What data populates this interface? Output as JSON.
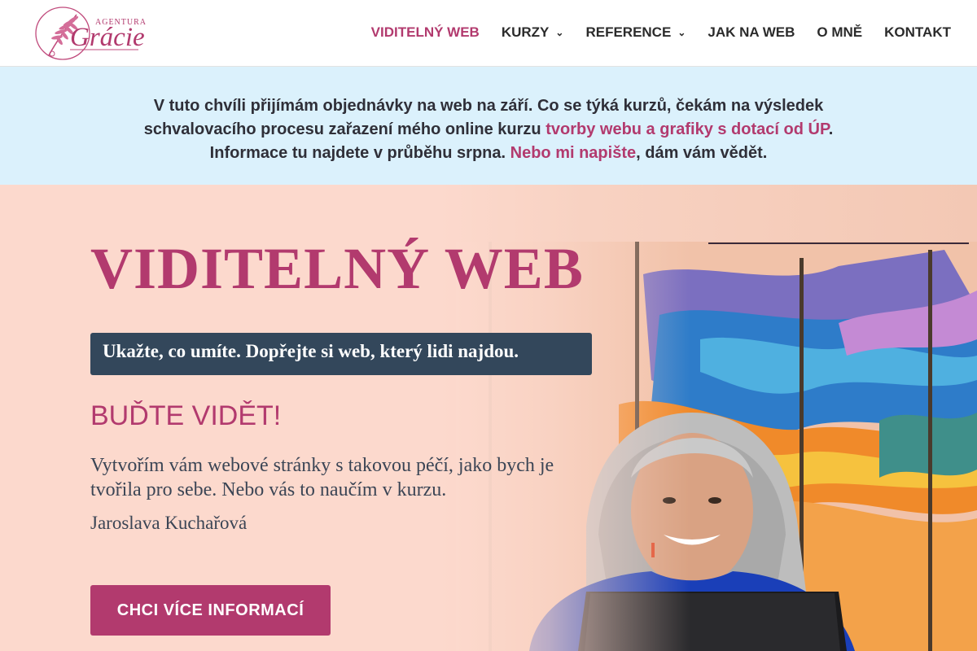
{
  "logo": {
    "small_text": "AGENTURA",
    "main_text": "Grácie"
  },
  "nav": {
    "items": [
      {
        "label": "VIDITELNÝ WEB"
      },
      {
        "label": "KURZY"
      },
      {
        "label": "REFERENCE"
      },
      {
        "label": "JAK NA WEB"
      },
      {
        "label": "O MNĚ"
      },
      {
        "label": "KONTAKT"
      }
    ]
  },
  "notice": {
    "line1": "V tuto chvíli přijímám objednávky na web na září. Co se týká kurzů, čekám na výsledek",
    "line2_before": "schvalovacího procesu zařazení mého online kurzu ",
    "line2_link": "tvorby webu a grafiky s dotací od ÚP",
    "line2_after": ".",
    "line3_before": "Informace tu najdete v průběhu srpna. ",
    "line3_link": "Nebo mi napište",
    "line3_after": ", dám vám vědět."
  },
  "hero": {
    "title": "VIDITELNÝ WEB",
    "tagline": "Ukažte, co umíte. Dopřejte si web, který lidi najdou.",
    "subheading": "BUĎTE VIDĚT!",
    "description": "Vytvořím vám webové stránky s takovou péčí, jako bych je tvořila pro sebe. Nebo vás to naučím v kurzu.",
    "author": "Jaroslava Kuchařová",
    "cta_label": "CHCI VÍCE INFORMACÍ"
  },
  "colors": {
    "accent": "#b23a6e",
    "notice_bg": "#dbf1fc",
    "hero_bg": "#fcd9cd",
    "tagline_bg": "#33475b"
  }
}
